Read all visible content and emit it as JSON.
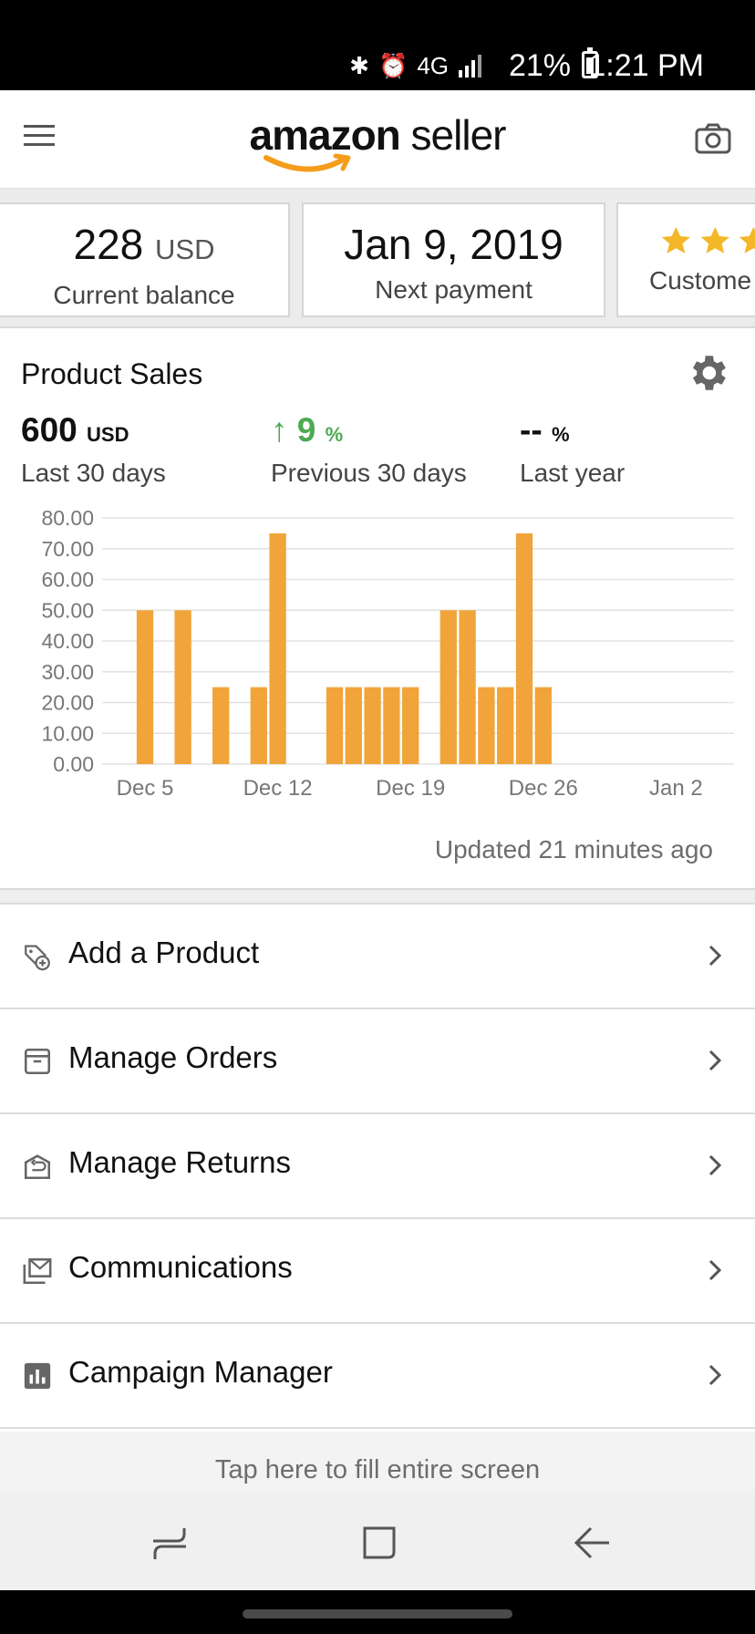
{
  "status_bar": {
    "battery_percent": "21%",
    "time": "1:21 PM",
    "network": "4G"
  },
  "header": {
    "logo_word1": "amazon",
    "logo_word2": " seller",
    "brand_accent": "#f59c1b"
  },
  "cards": [
    {
      "value": "228",
      "unit": "USD",
      "label": "Current balance"
    },
    {
      "value": "Jan 9, 2019",
      "label": "Next payment"
    },
    {
      "label": "Custome"
    }
  ],
  "sales": {
    "title": "Product Sales",
    "metrics": [
      {
        "value": "600",
        "unit": "USD",
        "label": "Last 30 days"
      },
      {
        "arrow": "↑",
        "value": "9",
        "unit": "%",
        "label": "Previous 30 days"
      },
      {
        "value": "--",
        "unit": "%",
        "label": "Last year"
      }
    ],
    "updated": "Updated 21 minutes ago",
    "trend_color": "#4caa52"
  },
  "chart_data": {
    "type": "bar",
    "color": "#f0a43a",
    "y_ticks": [
      "80.00",
      "70.00",
      "60.00",
      "50.00",
      "40.00",
      "30.00",
      "20.00",
      "10.00",
      "0.00"
    ],
    "ylim": [
      0,
      80
    ],
    "x_tick_labels": [
      "Dec 5",
      "Dec 12",
      "Dec 19",
      "Dec 26",
      "Jan 2"
    ],
    "categories": [
      "Dec 5",
      "Dec 6",
      "Dec 7",
      "Dec 8",
      "Dec 9",
      "Dec 10",
      "Dec 11",
      "Dec 12",
      "Dec 13",
      "Dec 14",
      "Dec 15",
      "Dec 16",
      "Dec 17",
      "Dec 18",
      "Dec 19",
      "Dec 20",
      "Dec 21",
      "Dec 22",
      "Dec 23",
      "Dec 24",
      "Dec 25",
      "Dec 26",
      "Dec 27",
      "Dec 28",
      "Dec 29",
      "Dec 30",
      "Dec 31",
      "Jan 1",
      "Jan 2"
    ],
    "values": [
      50,
      0,
      50,
      0,
      25,
      0,
      25,
      75,
      0,
      0,
      25,
      25,
      25,
      25,
      25,
      0,
      50,
      50,
      25,
      25,
      75,
      25,
      0,
      0,
      0,
      0,
      0,
      0,
      0
    ],
    "grid": true
  },
  "menu": [
    {
      "label": "Add a Product",
      "icon": "tag-plus-icon"
    },
    {
      "label": "Manage Orders",
      "icon": "box-icon"
    },
    {
      "label": "Manage Returns",
      "icon": "return-box-icon"
    },
    {
      "label": "Communications",
      "icon": "mail-stack-icon"
    },
    {
      "label": "Campaign Manager",
      "icon": "bar-chart-icon"
    }
  ],
  "fill_banner": "Tap here to fill entire screen"
}
